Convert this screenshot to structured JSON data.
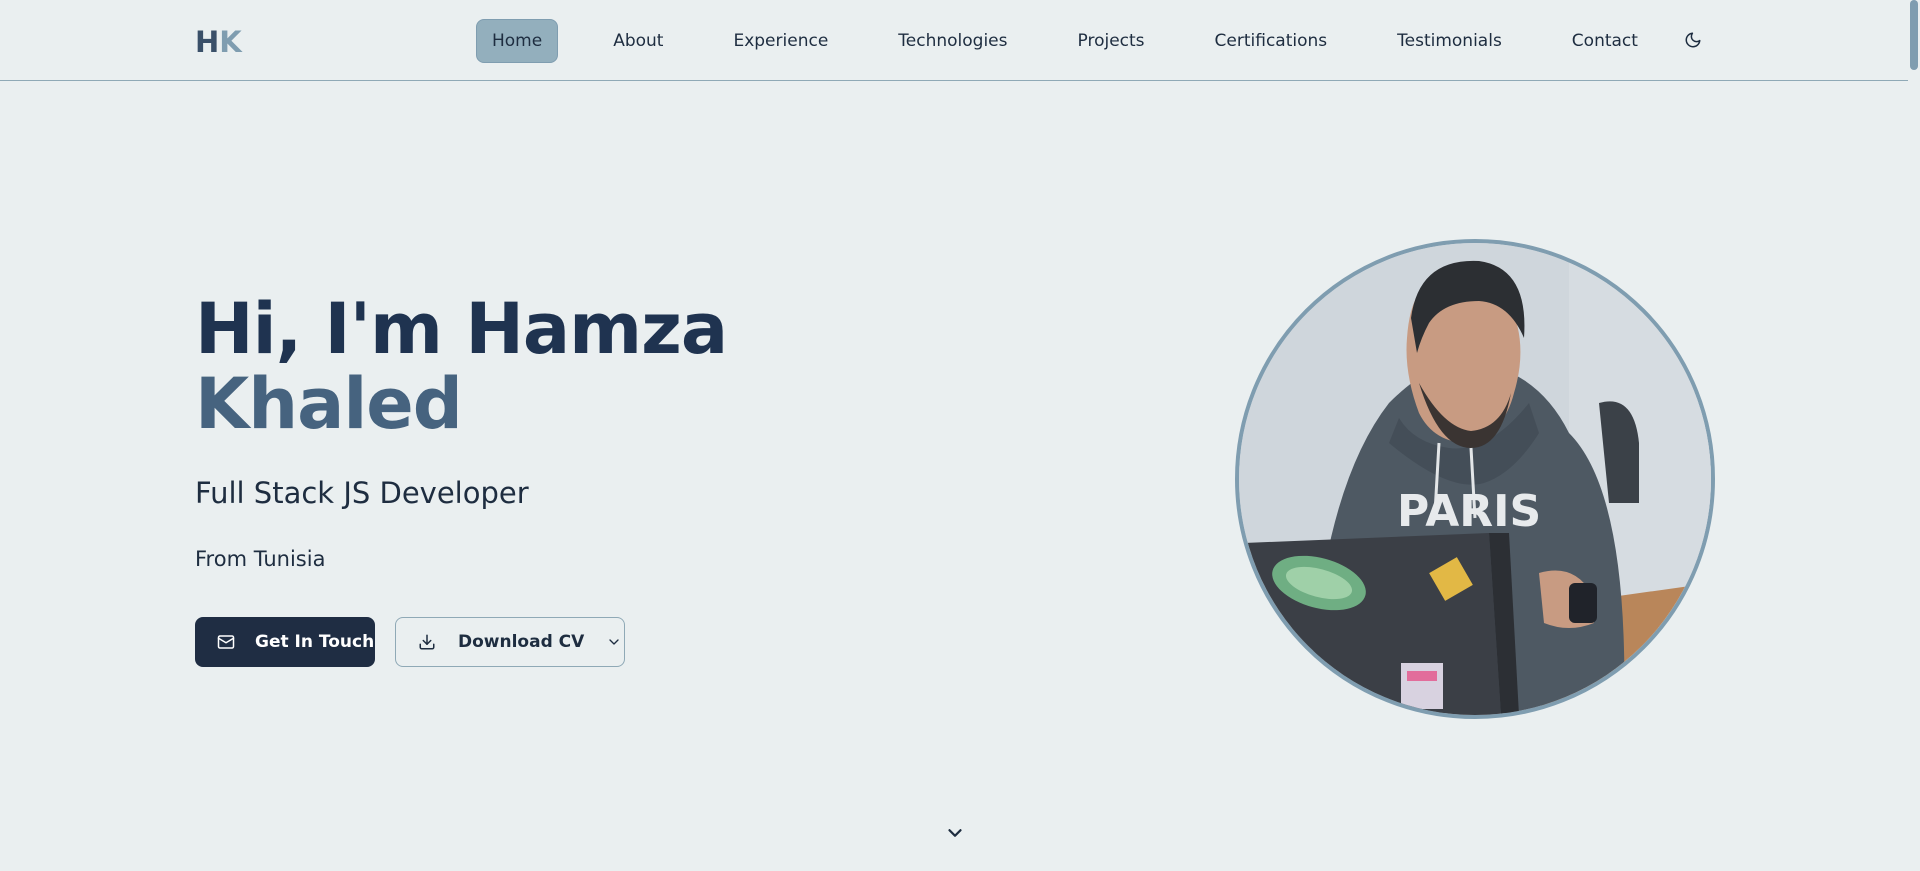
{
  "header": {
    "logo_h": "H",
    "logo_k": "K"
  },
  "nav": {
    "items": [
      {
        "label": "Home",
        "active": true
      },
      {
        "label": "About",
        "active": false
      },
      {
        "label": "Experience",
        "active": false
      },
      {
        "label": "Technologies",
        "active": false
      },
      {
        "label": "Projects",
        "active": false
      },
      {
        "label": "Certifications",
        "active": false
      },
      {
        "label": "Testimonials",
        "active": false
      },
      {
        "label": "Contact",
        "active": false
      }
    ],
    "theme_toggle_icon": "moon-icon"
  },
  "hero": {
    "title_line1": "Hi, I'm Hamza",
    "title_line2": "Khaled",
    "role": "Full Stack JS Developer",
    "location": "From Tunisia",
    "primary_button": {
      "label": "Get In Touch",
      "icon": "mail-icon"
    },
    "secondary_button": {
      "label": "Download CV",
      "icon": "download-icon",
      "trailing_icon": "chevron-down-icon"
    },
    "photo_sweatshirt_text": "PARIS",
    "scroll_icon": "chevron-down-icon"
  },
  "colors": {
    "background": "#eaeff0",
    "primary": "#1f2d43",
    "accent": "#7f9db0",
    "active_nav": "#93afbd",
    "title_dark": "#1f3350",
    "title_light": "#46637f"
  }
}
